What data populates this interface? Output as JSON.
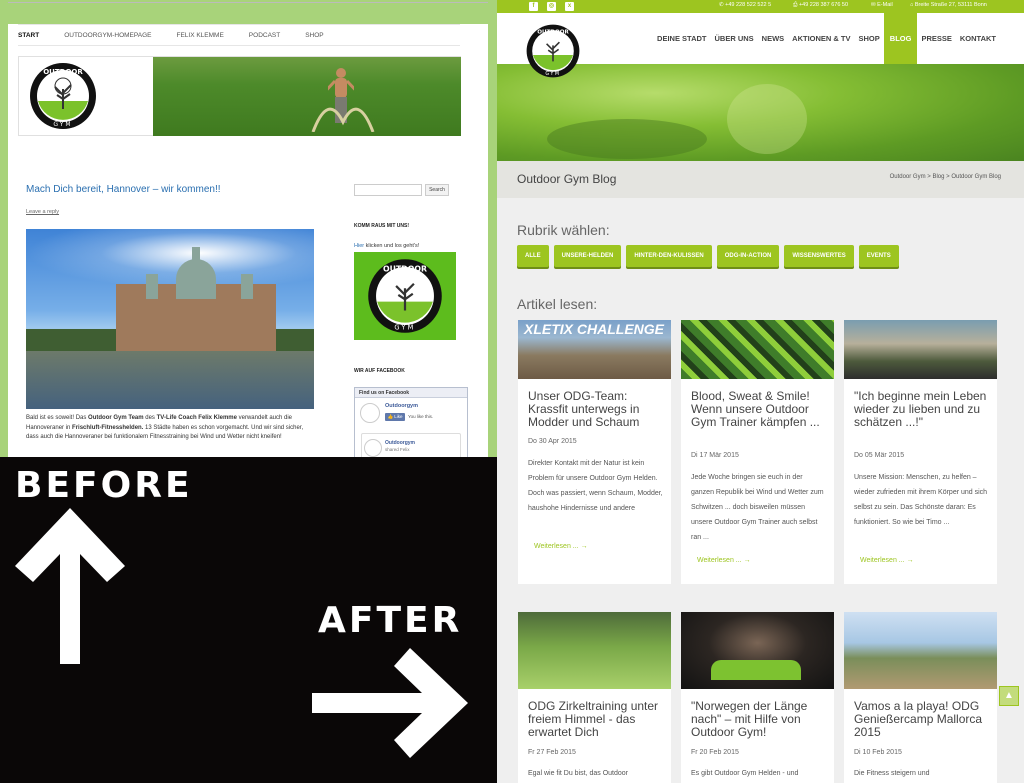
{
  "before": {
    "nav": [
      "START",
      "OUTDOORGYM-HOMEPAGE",
      "FELIX KLEMME",
      "PODCAST",
      "SHOP"
    ],
    "logo_text": "OUTDOOR",
    "logo_sub": "GYM",
    "post_title": "Mach Dich bereit, Hannover – wir kommen!!",
    "leave_reply": "Leave a reply",
    "body_1": "Bald ist es soweit! Das ",
    "body_b1": "Outdoor Gym Team",
    "body_2": " des ",
    "body_b2": "TV-Life Coach Felix Klemme",
    "body_3": " verwandelt auch die Hannoveraner in ",
    "body_b3": "Frischluft-Fitnesshelden.",
    "body_4": " 13 Städte haben es schon vorgemacht. Und wir sind sicher, dass auch die Hannoveraner bei funktionalem Fitnesstraining bei Wind und Wetter nicht kneifen!",
    "search_button": "Search",
    "sidebar_heading_1": "KOMM RAUS MIT UNS!",
    "sidebar_link": "Hier",
    "sidebar_text": " klicken und los geht's!",
    "sidebar_heading_2": "WIR AUF FACEBOOK",
    "fb_header": "Find us on Facebook",
    "fb_page": "Outdoorgym",
    "fb_like": "Like",
    "fb_likes_text": "You like this.",
    "fb_post_name": "Outdoorgym",
    "fb_post_shared": "shared Felix"
  },
  "labels": {
    "before": "BEFORE",
    "after": "AFTER"
  },
  "after": {
    "topbar": {
      "phone": "+49 228 522 522 5",
      "fax": "+49 228 387 676 50",
      "email": "E-Mail",
      "address": "Breite Straße 27, 53111 Bonn"
    },
    "nav": [
      "DEINE STADT",
      "ÜBER UNS",
      "NEWS",
      "AKTIONEN & TV",
      "SHOP",
      "BLOG",
      "PRESSE",
      "KONTAKT"
    ],
    "nav_active": "BLOG",
    "page_title": "Outdoor Gym Blog",
    "breadcrumb": [
      "Outdoor Gym",
      "Blog",
      "Outdoor Gym Blog"
    ],
    "breadcrumb_sep": ">",
    "rubrik_heading": "Rubrik wählen:",
    "categories": [
      "ALLE",
      "UNSERE-HELDEN",
      "HINTER-DEN-KULISSEN",
      "ODG-IN-ACTION",
      "WISSENSWERTES",
      "EVENTS"
    ],
    "articles_heading": "Artikel lesen:",
    "read_more": "Weiterlesen ...",
    "cards": [
      {
        "title": "Unser ODG-Team: Krassfit unterwegs in Modder und Schaum",
        "date": "Do 30 Apr 2015",
        "excerpt": "Direkter Kontakt mit der Natur ist kein Problem für unsere Outdoor Gym Helden. Doch was passiert, wenn Schaum, Modder, haushohe Hindernisse und andere",
        "img_caption": "XLETIX CHALLENGE"
      },
      {
        "title": "Blood, Sweat & Smile! Wenn unsere Outdoor Gym Trainer kämpfen ...",
        "date": "Di 17 Mär 2015",
        "excerpt": "Jede Woche bringen sie euch in der ganzen Republik bei Wind und Wetter zum Schwitzen ... doch bisweilen müssen unsere Outdoor Gym Trainer auch selbst ran ..."
      },
      {
        "title": "\"Ich beginne mein Leben wieder zu lieben und zu schätzen ...!\"",
        "date": "Do 05 Mär 2015",
        "excerpt": "Unsere Mission: Menschen, zu helfen – wieder zufrieden mit ihrem Körper und sich selbst zu sein. Das Schönste daran: Es funktioniert. So wie bei Timo ..."
      },
      {
        "title": "ODG Zirkeltraining unter freiem Himmel - das erwartet Dich",
        "date": "Fr 27 Feb 2015",
        "excerpt": "Egal wie fit Du bist, das Outdoor"
      },
      {
        "title": "\"Norwegen der Länge nach\" – mit Hilfe von Outdoor Gym!",
        "date": "Fr 20 Feb 2015",
        "excerpt": "Es gibt Outdoor Gym Helden - und"
      },
      {
        "title": "Vamos a la playa! ODG Genießercamp Mallorca 2015",
        "date": "Di 10 Feb 2015",
        "excerpt": "Die Fitness steigern und"
      }
    ]
  },
  "colors": {
    "accent": "#9dc520",
    "link": "#2a6fb0",
    "old_bg": "#a8d37a"
  }
}
